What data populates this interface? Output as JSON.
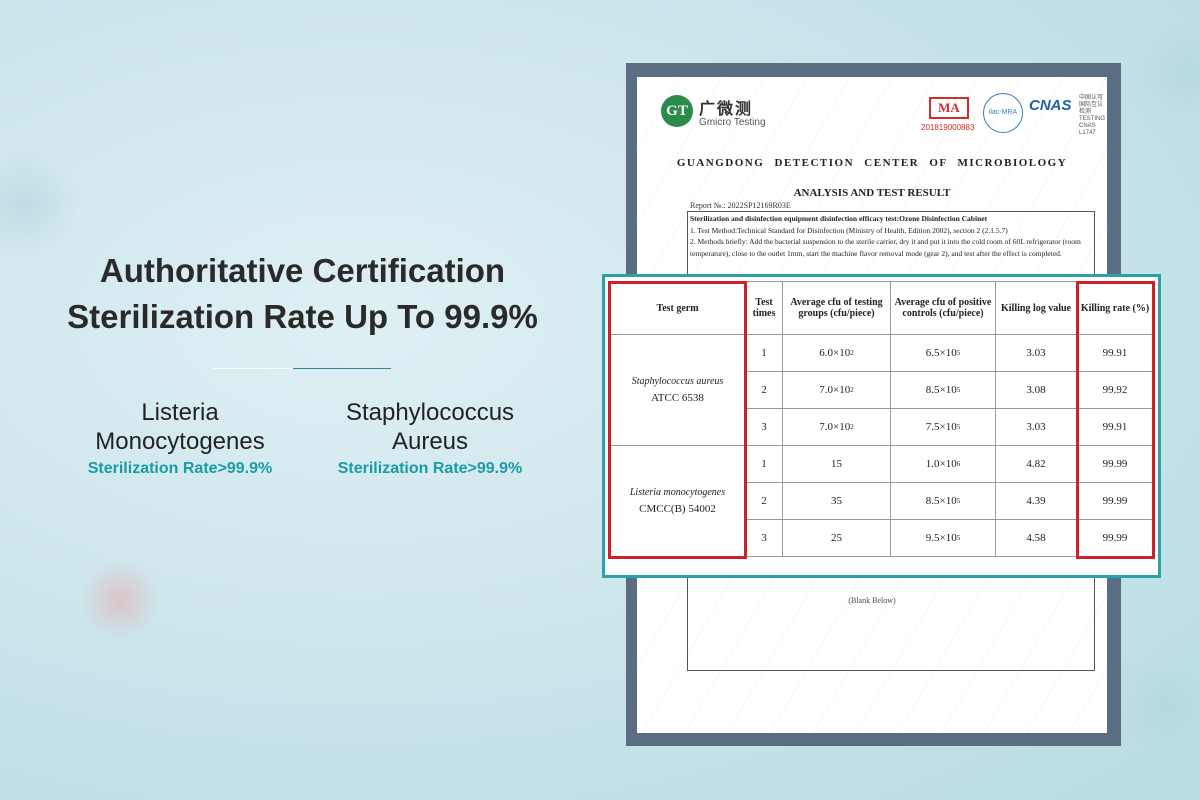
{
  "hero": {
    "line1": "Authoritative Certification",
    "line2": "Sterilization Rate Up To 99.9%"
  },
  "features": [
    {
      "name_line1": "Listeria",
      "name_line2": "Monocytogenes",
      "rate": "Sterilization Rate>99.9%"
    },
    {
      "name_line1": "Staphylococcus",
      "name_line2": "Aureus",
      "rate": "Sterilization Rate>99.9%"
    }
  ],
  "document": {
    "logo_text": "GT",
    "brand_cn": "广微测",
    "brand_en": "Gmicro Testing",
    "ma_mark": "MA",
    "ma_number": "201819000883",
    "ilac_mark": "ilac-MRA",
    "cnas_mark": "CNAS",
    "cnas_small": "中国认可 国际互认 检测 TESTING CNAS L1747",
    "org": "GUANGDONG DETECTION CENTER OF MICROBIOLOGY",
    "title": "ANALYSIS AND TEST RESULT",
    "report_no": "Report №.: 2022SP12169R03E",
    "method_title": "Sterilization and disinfection equipment disinfection efficacy test:Ozone Disinfection Cabinet",
    "method_1": "1. Test Method:Technical Standard for Disinfection (Ministry of Health, Edition 2002), section 2 (2.1.5.7)",
    "method_2": "2. Methods briefly: Add the bacterial suspension to the sterile carrier, dry it and put it into the cold room of 60L refrigerator (room temperature), close to the outlet 1mm, start the machine flavor removal mode (gear 2), and test after the effect is completed.",
    "blank": "(Blank Below)"
  },
  "table": {
    "headers": {
      "germ": "Test germ",
      "times": "Test times",
      "avg_test": "Average cfu of testing groups (cfu/piece)",
      "avg_ctrl": "Average cfu of positive controls (cfu/piece)",
      "log": "Killing log value",
      "rate": "Killing rate (%)"
    },
    "groups": [
      {
        "species": "Staphylococcus aureus",
        "strain": "ATCC 6538"
      },
      {
        "species": "Listeria monocytogenes",
        "strain": "CMCC(B) 54002"
      }
    ],
    "rows": [
      {
        "times": "1",
        "test_base": "6.0×10",
        "test_exp": "2",
        "ctrl_base": "6.5×10",
        "ctrl_exp": "5",
        "log": "3.03",
        "rate": "99.91"
      },
      {
        "times": "2",
        "test_base": "7.0×10",
        "test_exp": "2",
        "ctrl_base": "8.5×10",
        "ctrl_exp": "5",
        "log": "3.08",
        "rate": "99.92"
      },
      {
        "times": "3",
        "test_base": "7.0×10",
        "test_exp": "2",
        "ctrl_base": "7.5×10",
        "ctrl_exp": "5",
        "log": "3.03",
        "rate": "99.91"
      },
      {
        "times": "1",
        "test_base": "15",
        "test_exp": "",
        "ctrl_base": "1.0×10",
        "ctrl_exp": "6",
        "log": "4.82",
        "rate": "99.99"
      },
      {
        "times": "2",
        "test_base": "35",
        "test_exp": "",
        "ctrl_base": "8.5×10",
        "ctrl_exp": "5",
        "log": "4.39",
        "rate": "99.99"
      },
      {
        "times": "3",
        "test_base": "25",
        "test_exp": "",
        "ctrl_base": "9.5×10",
        "ctrl_exp": "5",
        "log": "4.58",
        "rate": "99.99"
      }
    ]
  },
  "colors": {
    "accent": "#1a9ca5",
    "highlight": "#cc1f2a",
    "frame": "#5a6d83"
  }
}
